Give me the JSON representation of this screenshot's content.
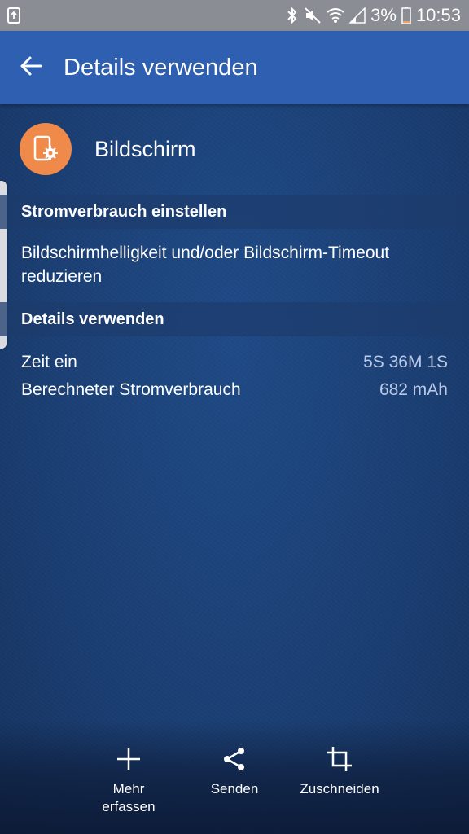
{
  "status_bar": {
    "battery_percent": "3%",
    "time": "10:53",
    "icons": [
      "notification-icon",
      "bluetooth-icon",
      "mute-icon",
      "wifi-icon",
      "signal-icon",
      "battery-icon"
    ]
  },
  "app_bar": {
    "title": "Details verwenden",
    "color": "#2f5fb0"
  },
  "app": {
    "name": "Bildschirm",
    "icon": "screen-settings-icon",
    "icon_color": "#f08a4b"
  },
  "tip_section": {
    "header": "Stromverbrauch einstellen",
    "text": "Bildschirmhelligkeit und/oder Bildschirm-Timeout reduzieren"
  },
  "details_section": {
    "header": "Details verwenden",
    "rows": [
      {
        "label": "Zeit ein",
        "value": "5S 36M 1S"
      },
      {
        "label": "Berechneter Stromverbrauch",
        "value": "682 mAh"
      }
    ]
  },
  "actions": [
    {
      "label": "Mehr erfassen",
      "icon": "plus-icon"
    },
    {
      "label": "Senden",
      "icon": "share-icon"
    },
    {
      "label": "Zuschneiden",
      "icon": "crop-icon"
    }
  ]
}
